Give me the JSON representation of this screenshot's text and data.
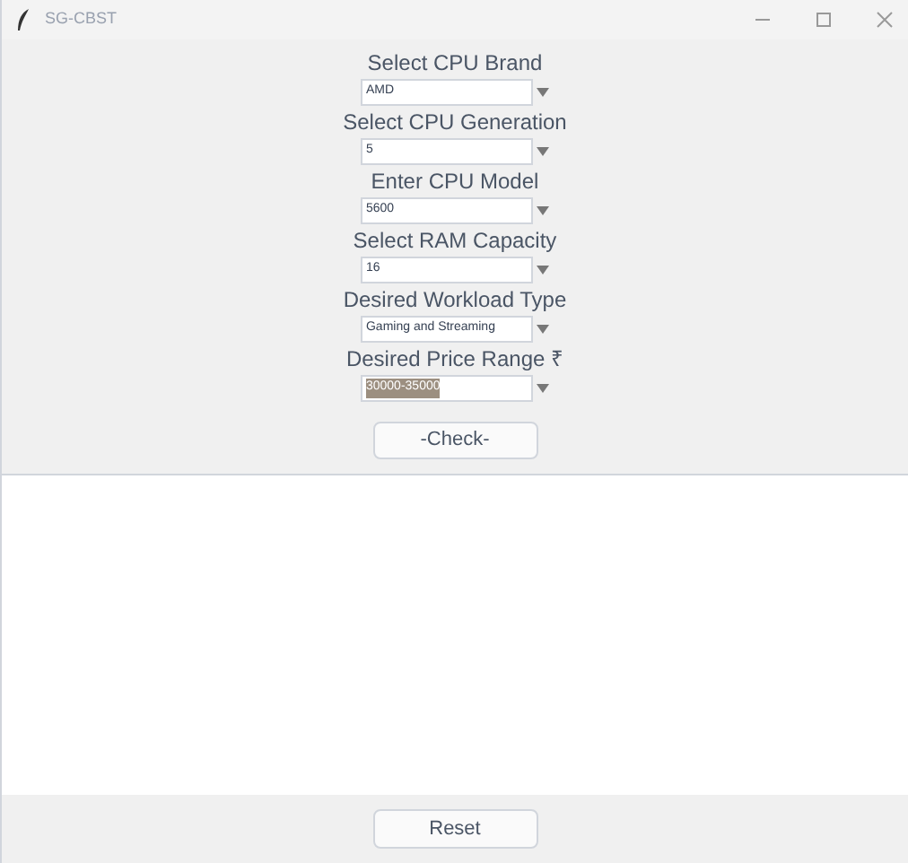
{
  "window": {
    "title": "SG-CBST"
  },
  "fields": [
    {
      "label": "Select CPU Brand",
      "value": "AMD",
      "selected": false
    },
    {
      "label": "Select CPU Generation",
      "value": "5",
      "selected": false
    },
    {
      "label": "Enter CPU Model",
      "value": "5600",
      "selected": false
    },
    {
      "label": "Select RAM Capacity",
      "value": "16",
      "selected": false
    },
    {
      "label": "Desired Workload Type",
      "value": "Gaming and Streaming",
      "selected": false
    },
    {
      "label": "Desired Price Range ₹",
      "value": "30000-35000",
      "selected": true
    }
  ],
  "check_button": "-Check-",
  "reset_button": "Reset"
}
